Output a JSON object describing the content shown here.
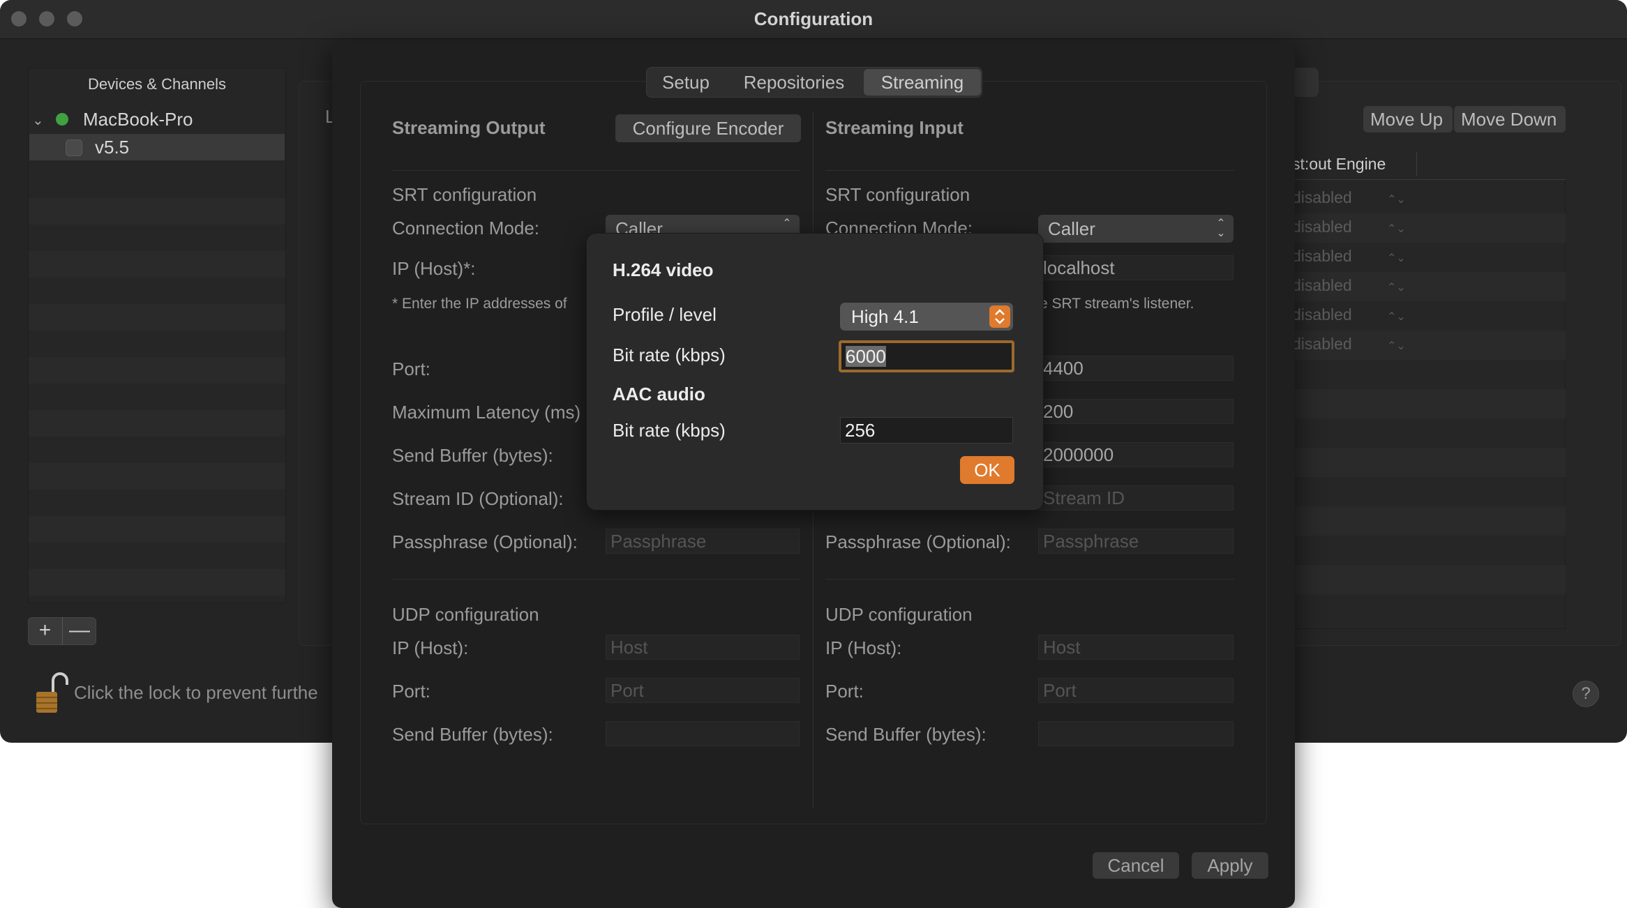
{
  "window": {
    "title": "Configuration"
  },
  "sidebar": {
    "header": "Devices & Channels",
    "device": "MacBook-Pro",
    "channel": "v5.5",
    "add_label": "+",
    "remove_label": "—"
  },
  "lock": {
    "text": "Click the lock to prevent furthe"
  },
  "back_panel": {
    "label": "L",
    "tab_stub": "l",
    "move_up": "Move Up",
    "move_down": "Move Down",
    "table_header": "st:out Engine",
    "rows": [
      "disabled",
      "disabled",
      "disabled",
      "disabled",
      "disabled",
      "disabled"
    ],
    "help": "?"
  },
  "tabs": [
    {
      "label": "Setup"
    },
    {
      "label": "Repositories"
    },
    {
      "label": "Streaming"
    }
  ],
  "output": {
    "title": "Streaming Output",
    "configure_encoder": "Configure Encoder",
    "srt_title": "SRT configuration",
    "connection_mode_label": "Connection Mode:",
    "connection_mode_value": "Caller",
    "ip_label": "IP (Host)*:",
    "note": "* Enter the IP addresses of",
    "port_label": "Port:",
    "latency_label": "Maximum Latency (ms)",
    "send_buffer_label": "Send Buffer (bytes):",
    "stream_id_label": "Stream ID (Optional):",
    "passphrase_label": "Passphrase (Optional):",
    "passphrase_placeholder": "Passphrase",
    "udp_title": "UDP configuration",
    "udp_ip_label": "IP (Host):",
    "udp_ip_placeholder": "Host",
    "udp_port_label": "Port:",
    "udp_port_placeholder": "Port",
    "udp_send_buffer_label": "Send Buffer (bytes):"
  },
  "input": {
    "title": "Streaming Input",
    "srt_title": "SRT configuration",
    "connection_mode_label": "Connection Mode:",
    "connection_mode_value": "Caller",
    "ip_value": "localhost",
    "note": "e SRT stream's listener.",
    "port_value": "4400",
    "latency_value": "200",
    "send_buffer_value": "2000000",
    "stream_id_placeholder": "Stream ID",
    "passphrase_label": "Passphrase (Optional):",
    "passphrase_placeholder": "Passphrase",
    "udp_title": "UDP configuration",
    "udp_ip_label": "IP (Host):",
    "udp_ip_placeholder": "Host",
    "udp_port_label": "Port:",
    "udp_port_placeholder": "Port",
    "udp_send_buffer_label": "Send Buffer (bytes):"
  },
  "encoder": {
    "video_heading": "H.264 video",
    "profile_label": "Profile / level",
    "profile_value": "High 4.1",
    "video_bitrate_label": "Bit rate (kbps)",
    "video_bitrate_value": "6000",
    "audio_heading": "AAC audio",
    "audio_bitrate_label": "Bit rate (kbps)",
    "audio_bitrate_value": "256",
    "ok": "OK"
  },
  "footer": {
    "cancel": "Cancel",
    "apply": "Apply"
  },
  "colors": {
    "accent": "#e07a2c",
    "status_green": "#3fa13f"
  }
}
